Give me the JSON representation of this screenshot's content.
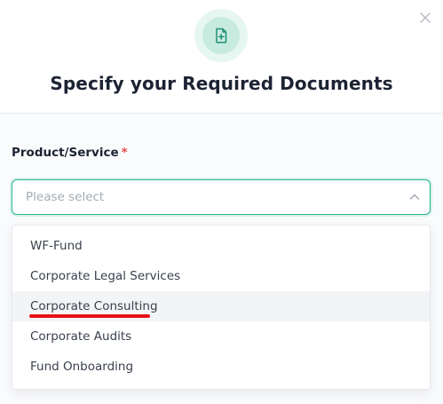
{
  "modal": {
    "title": "Specify your Required Documents",
    "header_icon": "document-plus-icon",
    "close_icon": "close-icon"
  },
  "form": {
    "product_label": "Product/Service",
    "required_marker": "*",
    "select_placeholder": "Please select",
    "chevron_icon": "chevron-up-icon"
  },
  "dropdown": {
    "options": [
      {
        "label": "WF-Fund"
      },
      {
        "label": "Corporate Legal Services"
      },
      {
        "label": "Corporate Consulting",
        "highlighted": true
      },
      {
        "label": "Corporate Audits"
      },
      {
        "label": "Fund Onboarding"
      }
    ]
  },
  "colors": {
    "accent": "#2bb391",
    "title": "#1c2333",
    "required": "#e5484d",
    "annotation": "#e8101a"
  }
}
